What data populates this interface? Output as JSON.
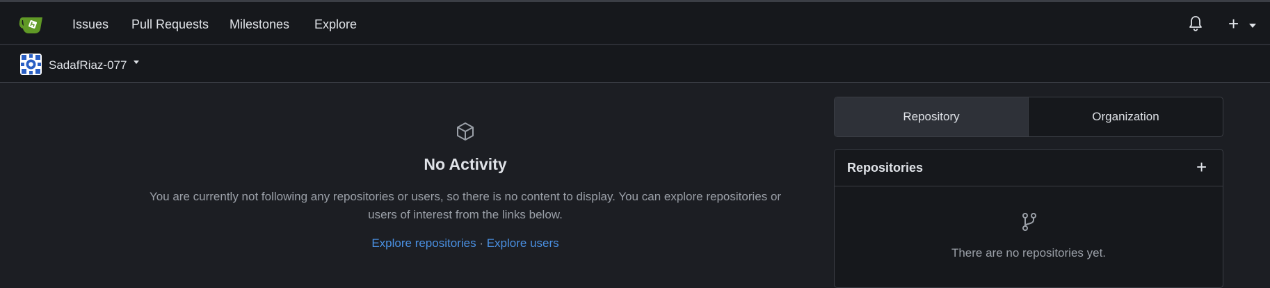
{
  "nav": {
    "items": [
      "Issues",
      "Pull Requests",
      "Milestones",
      "Explore"
    ],
    "logo_icon": "gitea-teapot-icon",
    "notifications_icon": "bell-icon",
    "create_label": "+"
  },
  "context": {
    "user_name": "SadafRiaz-077"
  },
  "feed": {
    "icon": "package-icon",
    "title": "No Activity",
    "description": "You are currently not following any repositories or users, so there is no content to display. You can explore repositories or users of interest from the links below.",
    "explore_repos": "Explore repositories",
    "separator": "·",
    "explore_users": "Explore users"
  },
  "sidebar": {
    "tabs": [
      {
        "label": "Repository",
        "active": true
      },
      {
        "label": "Organization",
        "active": false
      }
    ],
    "repositories": {
      "title": "Repositories",
      "add_label": "+",
      "empty_icon": "repo-forked-icon",
      "empty_text": "There are no repositories yet."
    }
  },
  "colors": {
    "background": "#1c1e23",
    "navbar": "#16181c",
    "link": "#4a90e2",
    "brand": "#609926"
  }
}
